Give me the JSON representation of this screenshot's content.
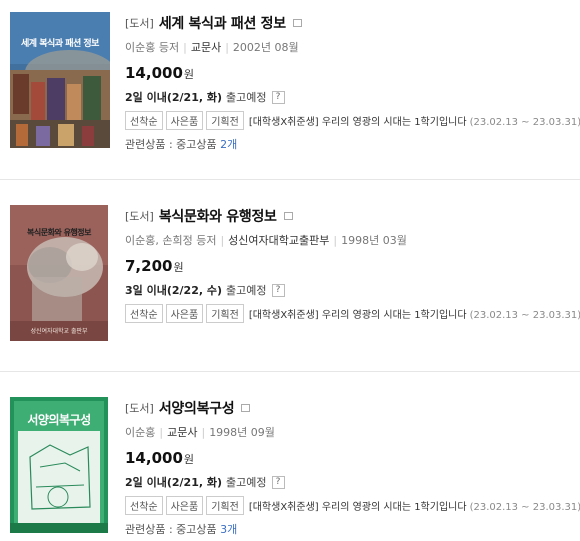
{
  "items": [
    {
      "category": "[도서]",
      "title": "세계 복식과 패션 정보",
      "author": "이순홍 등저",
      "publisher": "교문사",
      "date": "2002년 08월",
      "price": "14,000",
      "price_unit": "원",
      "shipping_when": "2일 이내(2/21, 화)",
      "shipping_state": "출고예정",
      "shipping_help": "?",
      "tags": [
        "선착순",
        "사은품",
        "기획전"
      ],
      "event_text": "[대학생X취준생] 우리의 영광의 시대는 1학기입니다",
      "event_date": "(23.02.13 ~ 23.03.31)",
      "related_label": "관련상품 : 중고상품",
      "related_count": "2개",
      "cover_title": "세계 복식과 패션 정보"
    },
    {
      "category": "[도서]",
      "title": "복식문화와 유행정보",
      "author": "이순홍, 손희정 등저",
      "publisher": "성신여자대학교출판부",
      "date": "1998년 03월",
      "price": "7,200",
      "price_unit": "원",
      "shipping_when": "3일 이내(2/22, 수)",
      "shipping_state": "출고예정",
      "shipping_help": "?",
      "tags": [
        "선착순",
        "사은품",
        "기획전"
      ],
      "event_text": "[대학생X취준생] 우리의 영광의 시대는 1학기입니다",
      "event_date": "(23.02.13 ~ 23.03.31)",
      "cover_title": "복식문화와 유행정보",
      "cover_publisher": "성신여자대학교 출판부"
    },
    {
      "category": "[도서]",
      "title": "서양의복구성",
      "author": "이순홍",
      "publisher": "교문사",
      "date": "1998년 09월",
      "price": "14,000",
      "price_unit": "원",
      "shipping_when": "2일 이내(2/21, 화)",
      "shipping_state": "출고예정",
      "shipping_help": "?",
      "tags": [
        "선착순",
        "사은품",
        "기획전"
      ],
      "event_text": "[대학생X취준생] 우리의 영광의 시대는 1학기입니다",
      "event_date": "(23.02.13 ~ 23.03.31)",
      "related_label": "관련상품 : 중고상품",
      "related_count": "3개",
      "cover_title": "서양의복구성"
    }
  ]
}
